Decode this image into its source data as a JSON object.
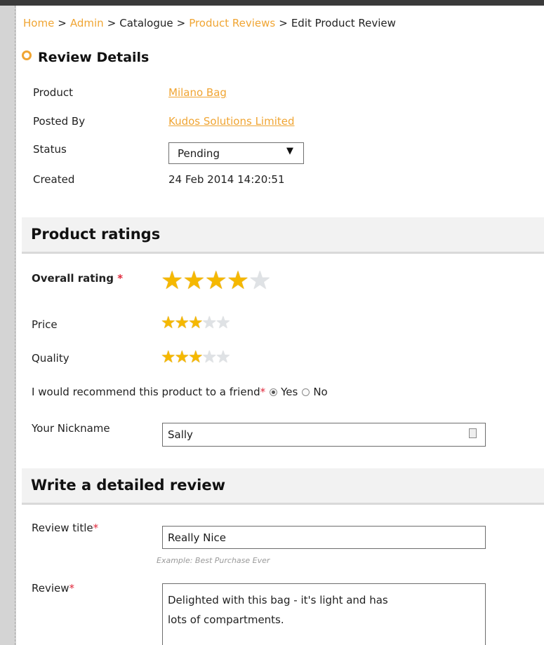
{
  "breadcrumb": {
    "home": "Home",
    "admin": "Admin",
    "catalogue": "Catalogue",
    "product_reviews": "Product Reviews",
    "current": "Edit Product Review",
    "separator": ">"
  },
  "review_details": {
    "heading": "Review Details",
    "product_label": "Product",
    "product_value": "Milano Bag",
    "posted_by_label": "Posted By",
    "posted_by_value": "Kudos Solutions Limited",
    "status_label": "Status",
    "status_value": "Pending",
    "created_label": "Created",
    "created_value": "24 Feb 2014 14:20:51"
  },
  "ratings": {
    "heading": "Product ratings",
    "overall_label": "Overall rating",
    "overall_value": 4,
    "price_label": "Price",
    "price_value": 3,
    "quality_label": "Quality",
    "quality_value": 3,
    "max_stars": 5,
    "required_mark": "*",
    "recommend_label": "I would recommend this product to a friend",
    "yes_label": "Yes",
    "no_label": "No",
    "recommend_selected": "Yes",
    "nickname_label": "Your Nickname",
    "nickname_value": "Sally"
  },
  "review": {
    "heading": "Write a detailed review",
    "title_label": "Review title",
    "title_value": "Really Nice",
    "title_hint": "Example: Best Purchase Ever",
    "review_label": "Review",
    "review_value": "Delighted with this bag - it's light and has\nlots of compartments."
  },
  "colors": {
    "accent": "#f0a533",
    "required": "#e0283b",
    "star_on": "#f5b800",
    "star_off": "#dfe2e5"
  },
  "icons": {
    "star": "star-icon",
    "dropdown": "dropdown-arrow-icon",
    "keyboard": "keyboard-icon",
    "bullet": "circle-bullet-icon"
  }
}
